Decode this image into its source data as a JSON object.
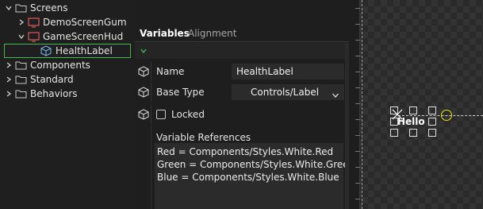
{
  "tree": {
    "items": [
      {
        "label": "Screens",
        "icon": "folder-icon",
        "expanded": true,
        "level": 0
      },
      {
        "label": "DemoScreenGum",
        "icon": "screen-icon",
        "expanded": false,
        "level": 1
      },
      {
        "label": "GameScreenHud",
        "icon": "screen-icon",
        "expanded": true,
        "level": 1
      },
      {
        "label": "HealthLabel",
        "icon": "instance-cube-icon",
        "selected": true,
        "level": 2
      },
      {
        "label": "Components",
        "icon": "folder-icon",
        "expanded": false,
        "level": 0
      },
      {
        "label": "Standard",
        "icon": "folder-icon",
        "expanded": false,
        "level": 0
      },
      {
        "label": "Behaviors",
        "icon": "folder-icon",
        "expanded": false,
        "level": 0
      }
    ]
  },
  "tabs": {
    "variables": "Variables",
    "alignment": "Alignment"
  },
  "properties": {
    "name_label": "Name",
    "name_value": "HealthLabel",
    "base_type_label": "Base Type",
    "base_type_value": "Controls/Label",
    "locked_label": "Locked",
    "locked_checked": false,
    "variable_references_label": "Variable References",
    "variable_references": [
      "Red = Components/Styles.White.Red",
      "Green = Components/Styles.White.Green",
      "Blue = Components/Styles.White.Blue"
    ]
  },
  "canvas": {
    "label_text": "Hello"
  },
  "colors": {
    "selection_border": "#3fb950",
    "screen_icon": "#e05a5a",
    "instance_icon": "#6fb3e8",
    "folder_icon": "#c8c8c8",
    "pivot_circle": "#e6e600"
  }
}
